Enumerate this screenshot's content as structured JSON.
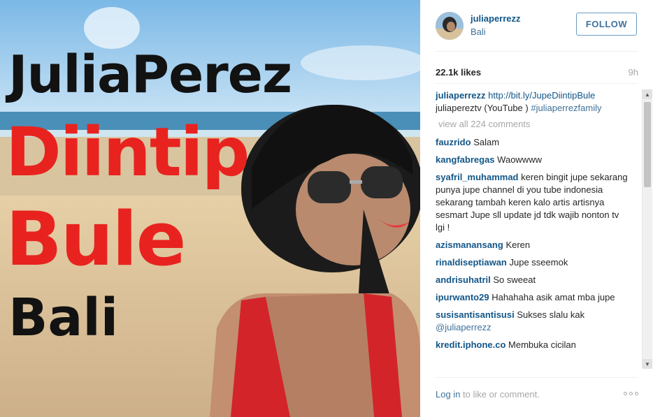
{
  "photo": {
    "overlay_line1": "JuliaPerez",
    "overlay_line2": "Diintip",
    "overlay_line3": "Bule",
    "overlay_line4": "Bali"
  },
  "header": {
    "username": "juliaperrezz",
    "location": "Bali",
    "follow_label": "FOLLOW"
  },
  "stats": {
    "likes": "22.1k likes",
    "time_ago": "9h"
  },
  "caption": {
    "user": "juliaperrezz",
    "link": "http://bit.ly/JupeDiintipBule",
    "text": "juliapereztv (YouTube )",
    "hashtag": "#juliaperrezfamily"
  },
  "view_all": "view all 224 comments",
  "comments": [
    {
      "user": "fauzrido",
      "text": "Salam"
    },
    {
      "user": "kangfabregas",
      "text": "Waowwww"
    },
    {
      "user": "syafril_muhammad",
      "text": "keren bingit jupe sekarang punya jupe channel di you tube indonesia sekarang tambah keren kalo artis artisnya sesmart Jupe sll update jd tdk wajib nonton tv lgi !"
    },
    {
      "user": "azismanansang",
      "text": "Keren"
    },
    {
      "user": "rinaldiseptiawan",
      "text": "Jupe sseemok"
    },
    {
      "user": "andrisuhatril",
      "text": "So sweeat"
    },
    {
      "user": "ipurwanto29",
      "text": "Hahahaha asik amat mba jupe"
    },
    {
      "user": "susisantisantisusi",
      "text": "Sukses slalu kak",
      "mention": "@juliaperrezz"
    },
    {
      "user": "kredit.iphone.co",
      "text": "Membuka cicilan"
    }
  ],
  "footer": {
    "login_link": "Log in",
    "login_rest": " to like or comment."
  },
  "colors": {
    "link_blue": "#125688",
    "accent_blue": "#3f729b",
    "muted_gray": "#a5a7aa",
    "overlay_red": "#e8231f"
  },
  "icons": [
    "more-options-icon",
    "scroll-up-arrow-icon",
    "scroll-down-arrow-icon"
  ]
}
